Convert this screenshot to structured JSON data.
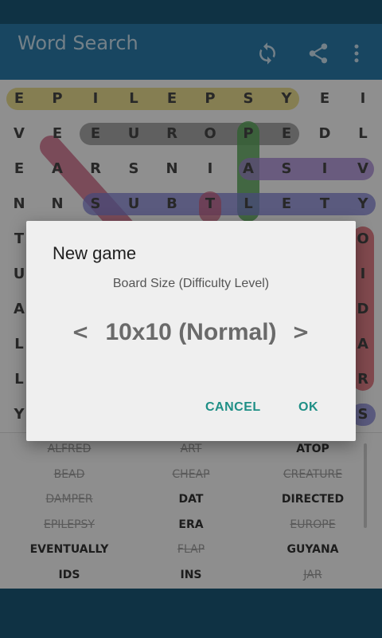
{
  "app": {
    "title": "Word Search",
    "icons": [
      "refresh-icon",
      "share-icon",
      "more-vert-icon"
    ],
    "colors": {
      "status_bar": "#1a5675",
      "app_bar": "#2a79a7",
      "accent": "#1f8f86"
    }
  },
  "board": {
    "rows": [
      [
        "E",
        "P",
        "I",
        "L",
        "E",
        "P",
        "S",
        "Y",
        "E",
        "I"
      ],
      [
        "V",
        "E",
        "E",
        "U",
        "R",
        "O",
        "P",
        "E",
        "D",
        "L"
      ],
      [
        "E",
        "A",
        "R",
        "S",
        "N",
        "I",
        "A",
        "S",
        "I",
        "V"
      ],
      [
        "N",
        "N",
        "S",
        "U",
        "B",
        "T",
        "L",
        "E",
        "T",
        "Y"
      ],
      [
        "T",
        "",
        "",
        "",
        "",
        "",
        "",
        "",
        "",
        "O"
      ],
      [
        "U",
        "",
        "",
        "",
        "",
        "",
        "",
        "",
        "",
        "I"
      ],
      [
        "A",
        "",
        "",
        "",
        "",
        "",
        "",
        "",
        "",
        "D"
      ],
      [
        "L",
        "",
        "",
        "",
        "",
        "",
        "",
        "",
        "",
        "A"
      ],
      [
        "L",
        "",
        "",
        "",
        "",
        "",
        "",
        "",
        "",
        "R"
      ],
      [
        "Y",
        "",
        "",
        "",
        "",
        "",
        "",
        "",
        "",
        "S"
      ]
    ],
    "highlight_colors": [
      "#e6d98e",
      "#6e6e6e",
      "#c75b7a",
      "#5aa65a",
      "#8f6fc4",
      "#6c6cc4",
      "#d9626b"
    ]
  },
  "word_list": {
    "rows": [
      [
        {
          "text": "ALFRED",
          "found": true
        },
        {
          "text": "ART",
          "found": true
        },
        {
          "text": "ATOP",
          "found": false
        }
      ],
      [
        {
          "text": "BEAD",
          "found": true
        },
        {
          "text": "CHEAP",
          "found": true
        },
        {
          "text": "CREATURE",
          "found": true
        }
      ],
      [
        {
          "text": "DAMPER",
          "found": true
        },
        {
          "text": "DAT",
          "found": false
        },
        {
          "text": "DIRECTED",
          "found": false
        }
      ],
      [
        {
          "text": "EPILEPSY",
          "found": true
        },
        {
          "text": "ERA",
          "found": false
        },
        {
          "text": "EUROPE",
          "found": true
        }
      ],
      [
        {
          "text": "EVENTUALLY",
          "found": false
        },
        {
          "text": "FLAP",
          "found": true
        },
        {
          "text": "GUYANA",
          "found": false
        }
      ],
      [
        {
          "text": "IDS",
          "found": false
        },
        {
          "text": "INS",
          "found": false
        },
        {
          "text": "JAR",
          "found": true
        }
      ]
    ]
  },
  "dialog": {
    "title": "New game",
    "subtitle": "Board Size (Difficulty Level)",
    "prev": "<",
    "value": "10x10 (Normal)",
    "next": ">",
    "cancel": "CANCEL",
    "ok": "OK"
  }
}
